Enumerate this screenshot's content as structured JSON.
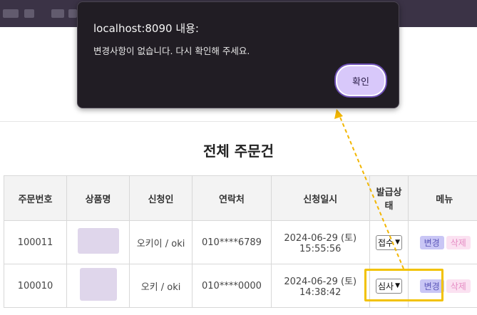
{
  "dialog": {
    "title": "localhost:8090 내용:",
    "message": "변경사항이 없습니다. 다시 확인해 주세요.",
    "ok_label": "확인"
  },
  "page": {
    "title": "전체 주문건"
  },
  "table": {
    "headers": [
      "주문번호",
      "상품명",
      "신청인",
      "연락처",
      "신청일시",
      "발급상태",
      "메뉴"
    ],
    "rows": [
      {
        "order_no": "100011",
        "applicant": "오키이 / oki",
        "phone": "010****6789",
        "date": "2024-06-29 (토)",
        "time": "15:55:56",
        "status": "접수",
        "change": "변경",
        "delete": "삭제"
      },
      {
        "order_no": "100010",
        "applicant": "오키 / oki",
        "phone": "010****0000",
        "date": "2024-06-29 (토)",
        "time": "14:38:42",
        "status": "심사",
        "change": "변경",
        "delete": "삭제"
      }
    ]
  },
  "colors": {
    "topbar": "#3b3346",
    "dialog_bg": "#211d24",
    "ok_button": "#d8c8fa",
    "highlight": "#f2c200",
    "change_button": "#c9c6f5",
    "delete_button": "#fbe1f1"
  }
}
